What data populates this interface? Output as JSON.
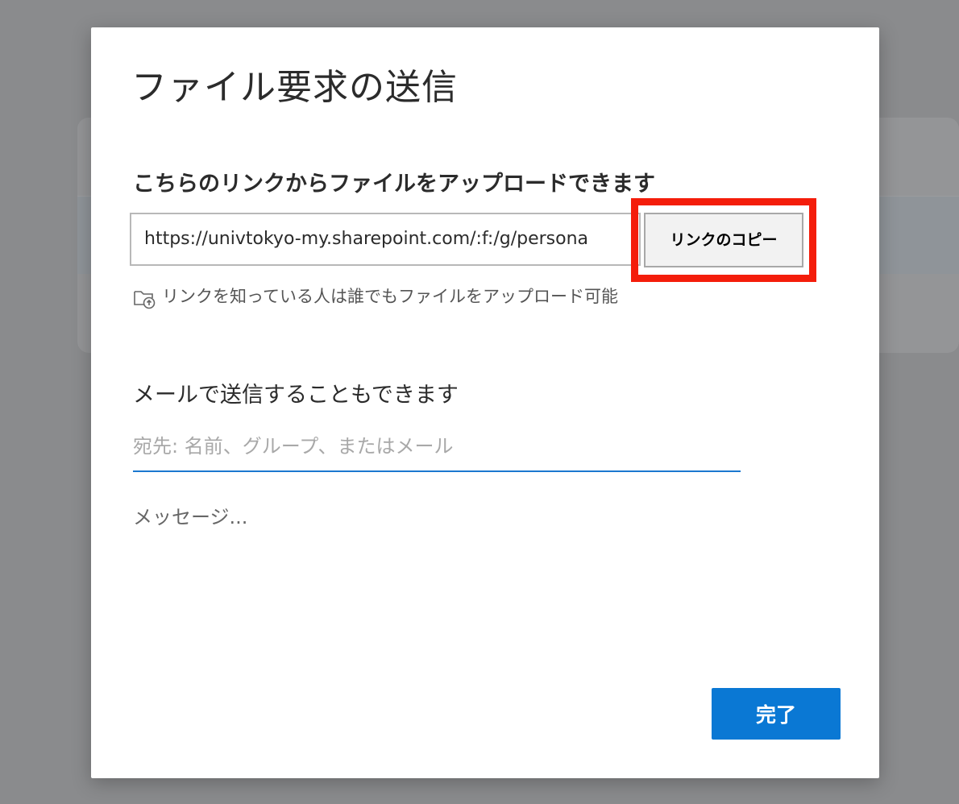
{
  "dialog": {
    "title": "ファイル要求の送信",
    "upload_heading": "こちらのリンクからファイルをアップロードできます",
    "link_value": "https://univtokyo-my.sharepoint.com/:f:/g/persona",
    "copy_button_label": "リンクのコピー",
    "permission_text": "リンクを知っている人は誰でもファイルをアップロード可能",
    "permission_icon": "folder-upload-icon",
    "email_heading": "メールで送信することもできます",
    "recipient_placeholder": "宛先: 名前、グループ、またはメール",
    "message_placeholder": "メッセージ...",
    "done_button_label": "完了"
  },
  "colors": {
    "accent": "#0a78d4",
    "highlight": "#f41d0b",
    "backdrop": "#8a8b8d"
  }
}
